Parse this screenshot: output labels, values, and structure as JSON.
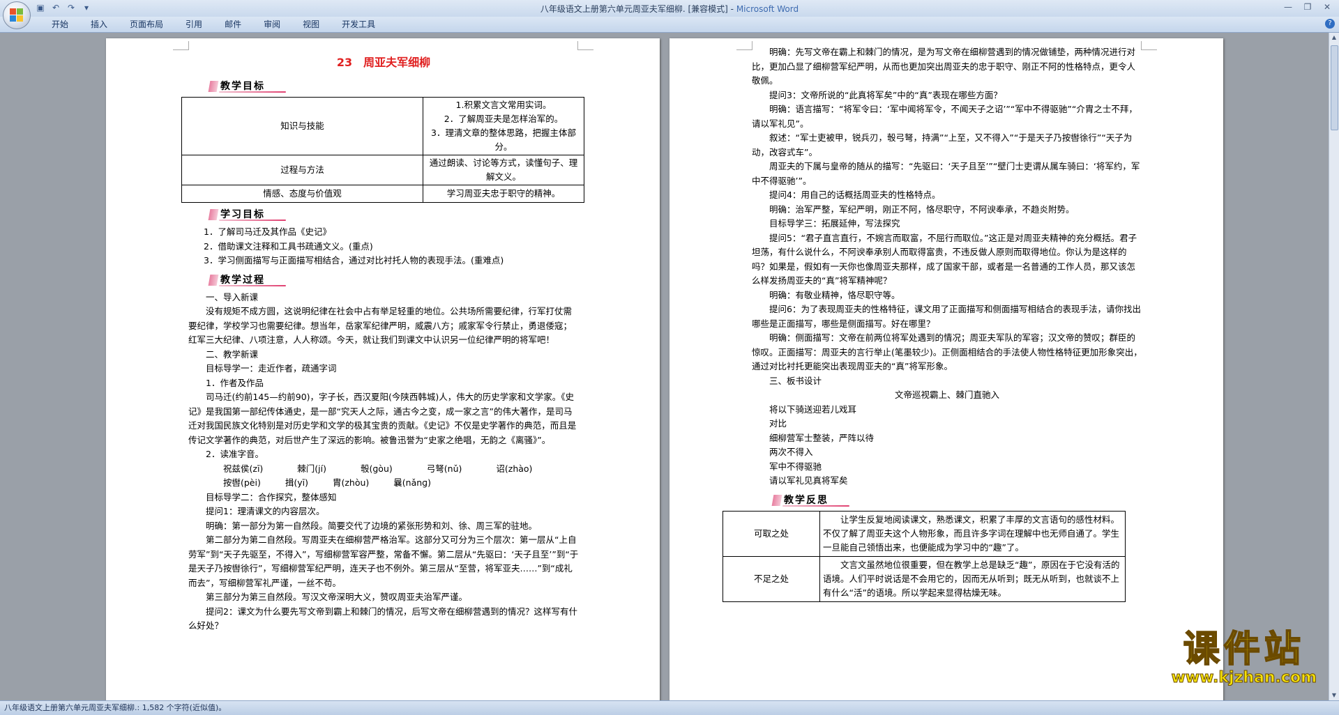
{
  "window": {
    "title": "八年级语文上册第六单元周亚夫军细柳. [兼容模式] - ",
    "app_name": "Microsoft Word"
  },
  "ribbon_tabs": [
    "开始",
    "插入",
    "页面布局",
    "引用",
    "邮件",
    "审阅",
    "视图",
    "开发工具"
  ],
  "page1": {
    "title": "23　周亚夫军细柳",
    "sec_teach_goal": "教学目标",
    "goal_table": [
      {
        "label": "知识与技能",
        "content": [
          "1.积累文言文常用实词。",
          "2．了解周亚夫是怎样治军的。",
          "3．理清文章的整体思路，把握主体部分。"
        ]
      },
      {
        "label": "过程与方法",
        "content": [
          "通过朗读、讨论等方式，读懂句子、理解文义。"
        ]
      },
      {
        "label": "情感、态度与价值观",
        "content": [
          "学习周亚夫忠于职守的精神。"
        ]
      }
    ],
    "sec_learn_goal": "学习目标",
    "learn_goals": [
      "1．了解司马迁及其作品《史记》",
      "2．借助课文注释和工具书疏通文义。(重点)",
      "3．学习侧面描写与正面描写相结合，通过对比衬托人物的表现手法。(重难点)"
    ],
    "sec_process": "教学过程",
    "p_intro_head": "一、导入新课",
    "p_intro": "没有规矩不成方圆，这说明纪律在社会中占有举足轻重的地位。公共场所需要纪律，行军打仗需要纪律，学校学习也需要纪律。想当年，岳家军纪律严明，威震八方；戚家军令行禁止，勇退倭寇；红军三大纪律、八项注意，人人称颂。今天，就让我们到课文中认识另一位纪律严明的将军吧！",
    "p_new_head": "二、教学新课",
    "p_goal1": "目标导学一：走近作者，疏通字词",
    "p_author_head": "1．作者及作品",
    "p_author": "司马迁(约前145—约前90)，字子长，西汉夏阳(今陕西韩城)人，伟大的历史学家和文学家。《史记》是我国第一部纪传体通史，是一部“究天人之际，通古今之变，成一家之言”的伟大著作，是司马迁对我国民族文化特别是对历史学和文学的极其宝贵的贡献。《史记》不仅是史学著作的典范，而且是传记文学著作的典范，对后世产生了深远的影响。被鲁迅誉为“史家之绝唱，无韵之《离骚》”。",
    "p_pron_head": "2．读准字音。",
    "pron_row1": [
      "祝兹侯(zī)",
      "棘门(jí)",
      "彀(ɡòu)",
      "弓弩(nǔ)",
      "诏(zhào)"
    ],
    "pron_row2": [
      "按辔(pèi)",
      "揖(yī)",
      "胄(zhòu)",
      "曩(nǎnɡ)"
    ],
    "p_goal2": "目标导学二：合作探究，整体感知",
    "p_q1": "提问1：理清课文的内容层次。",
    "p_a1": "明确：第一部分为第一自然段。简要交代了边境的紧张形势和刘、徐、周三军的驻地。",
    "p_a1b": "第二部分为第二自然段。写周亚夫在细柳营严格治军。这部分又可分为三个层次：第一层从“上自劳军”到“天子先驱至，不得入”，写细柳营军容严整，常备不懈。第二层从“先驱曰：‘天子且至’”到“于是天子乃按辔徐行”，写细柳营军纪严明，连天子也不例外。第三层从“至营，将军亚夫……”到“成礼而去”，写细柳营军礼严谨，一丝不苟。",
    "p_a1c": "第三部分为第三自然段。写汉文帝深明大义，赞叹周亚夫治军严谨。",
    "p_q2": "提问2：课文为什么要先写文帝到霸上和棘门的情况，后写文帝在细柳营遇到的情况？这样写有什么好处？"
  },
  "page2": {
    "p_a2": "明确：先写文帝在霸上和棘门的情况，是为写文帝在细柳营遇到的情况做铺垫，两种情况进行对比，更加凸显了细柳营军纪严明，从而也更加突出周亚夫的忠于职守、刚正不阿的性格特点，更令人敬佩。",
    "p_q3": "提问3：文帝所说的“此真将军矣”中的“真”表现在哪些方面？",
    "p_a3": "明确：语言描写：“将军令曰：‘军中闻将军令，不闻天子之诏’”“军中不得驱驰”“介胄之士不拜，请以军礼见”。",
    "p_a3b": "叙述：“军士吏被甲，锐兵刃，彀弓弩，持满”“上至，又不得入”“于是天子乃按辔徐行”“天子为动，改容式车”。",
    "p_a3c": "周亚夫的下属与皇帝的随从的描写：“先驱曰：‘天子且至’”“壁门士吏谓从属车骑曰：‘将军约，军中不得驱驰’”。",
    "p_q4": "提问4：用自己的话概括周亚夫的性格特点。",
    "p_a4": "明确：治军严整，军纪严明，刚正不阿，恪尽职守，不阿谀奉承，不趋炎附势。",
    "p_goal3": "目标导学三：拓展延伸，写法探究",
    "p_q5": "提问5：“君子直言直行，不婉言而取富，不屈行而取位。”这正是对周亚夫精神的充分概括。君子坦荡，有什么说什么，不阿谀奉承别人而取得富贵，不违反做人原则而取得地位。你认为是这样的吗？如果是，假如有一天你也像周亚夫那样，成了国家干部，或者是一名普通的工作人员，那又该怎么样发扬周亚夫的“真”将军精神呢？",
    "p_a5": "明确：有敬业精神，恪尽职守等。",
    "p_q6": "提问6：为了表现周亚夫的性格特征，课文用了正面描写和侧面描写相结合的表现手法，请你找出哪些是正面描写，哪些是侧面描写。好在哪里？",
    "p_a6": "明确：侧面描写：文帝在前两位将军处遇到的情况；周亚夫军队的军容；汉文帝的赞叹；群臣的惊叹。正面描写：周亚夫的言行举止(笔墨较少)。正侧面相结合的手法使人物性格特征更加形象突出，通过对比衬托更能突出表现周亚夫的“真”将军形象。",
    "p_board_head": "三、板书设计",
    "board_title": "文帝巡视霸上、棘门直驰入",
    "board_lines": [
      "将以下骑送迎若儿戏耳",
      "对比",
      "细柳营军士整装，严阵以待",
      "两次不得入",
      "军中不得驱驰",
      "请以军礼见真将军矣"
    ],
    "sec_reflect": "教学反思",
    "reflect_table": [
      {
        "label": "可取之处",
        "content": "让学生反复地阅读课文，熟悉课文，积累了丰厚的文言语句的感性材料。不仅了解了周亚夫这个人物形象，而且许多字词在理解中也无师自通了。学生一旦能自己领悟出来，也便能成为学习中的“趣”了。"
      },
      {
        "label": "不足之处",
        "content": "文言文虽然地位很重要，但在教学上总是缺乏“趣”，原因在于它没有活的语境。人们平时说话是不会用它的，因而无从听到；既无从听到，也就谈不上有什么“活”的语境。所以学起来显得枯燥无味。"
      }
    ]
  },
  "status_bar": "八年级语文上册第六单元周亚夫军细柳.: 1,582 个字符(近似值)。",
  "watermark": {
    "big": "课件站",
    "url": "www.kjzhan.com"
  }
}
